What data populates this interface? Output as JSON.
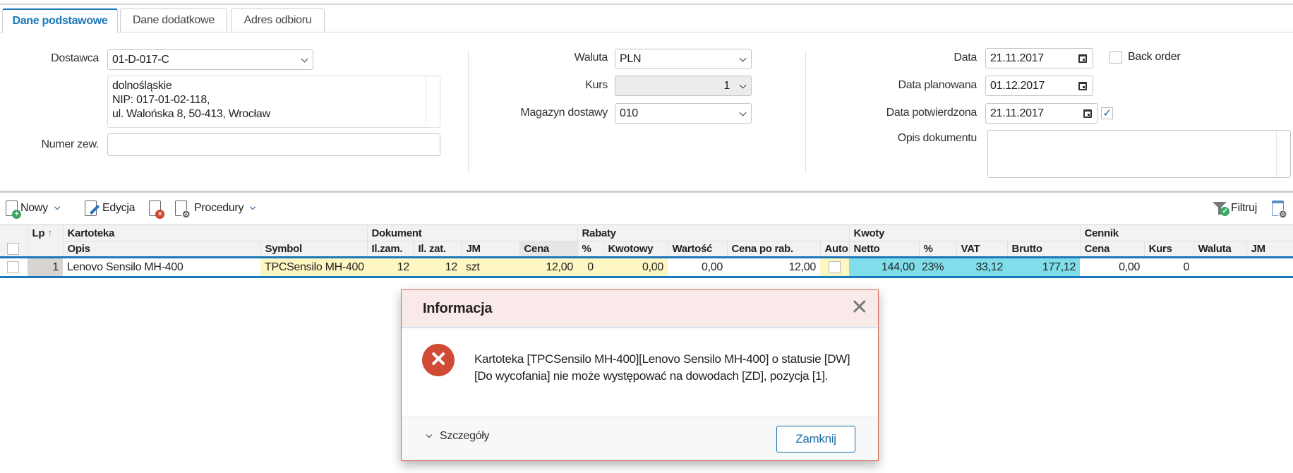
{
  "tabs": [
    {
      "label": "Dane podstawowe",
      "active": true
    },
    {
      "label": "Dane dodatkowe"
    },
    {
      "label": "Adres odbioru"
    }
  ],
  "form": {
    "dostawca": {
      "label": "Dostawca",
      "value": "01-D-017-C"
    },
    "address": [
      "dolnośląskie",
      "NIP: 017-01-02-118,",
      "ul. Walońska 8, 50-413, Wrocław"
    ],
    "numer_zew": {
      "label": "Numer zew.",
      "value": ""
    },
    "waluta": {
      "label": "Waluta",
      "value": "PLN"
    },
    "kurs": {
      "label": "Kurs",
      "value": "1"
    },
    "magazyn": {
      "label": "Magazyn dostawy",
      "value": "010"
    },
    "data": {
      "label": "Data",
      "value": "21.11.2017"
    },
    "back_order": {
      "label": "Back order",
      "checked": false
    },
    "data_planowana": {
      "label": "Data planowana",
      "value": "01.12.2017"
    },
    "data_potwierdzona": {
      "label": "Data potwierdzona",
      "value": "21.11.2017",
      "confirmed": true,
      "check": "✓"
    },
    "opis_dokumentu": {
      "label": "Opis dokumentu",
      "value": ""
    }
  },
  "toolbar": {
    "nowy": "Nowy",
    "edycja": "Edycja",
    "procedury": "Procedury",
    "filtruj": "Filtruj"
  },
  "grid": {
    "groups": {
      "lp": "Lp",
      "kartoteka": "Kartoteka",
      "dokument": "Dokument",
      "rabaty": "Rabaty",
      "kwoty": "Kwoty",
      "cennik": "Cennik"
    },
    "columns": [
      "Opis",
      "Symbol",
      "Il.zam.",
      "Il. zat.",
      "JM",
      "Cena",
      "%",
      "Kwotowy",
      "Wartość",
      "Cena po rab.",
      "Auto",
      "Netto",
      "%",
      "VAT",
      "Brutto",
      "Cena",
      "Kurs",
      "Waluta",
      "JM"
    ],
    "rows": [
      {
        "lp": "1",
        "opis": "Lenovo Sensilo MH-400",
        "symbol": "TPCSensilo MH-400",
        "il_zam": "12",
        "il_zat": "12",
        "jm": "szt",
        "cena": "12,00",
        "rab_pct": "0",
        "kwotowy": "0,00",
        "wartosc": "0,00",
        "cena_po_rab": "12,00",
        "auto": false,
        "netto": "144,00",
        "vat_pct": "23%",
        "vat": "33,12",
        "brutto": "177,12",
        "cennik_cena": "0,00",
        "cennik_kurs": "0",
        "cennik_waluta": "",
        "cennik_jm": ""
      }
    ]
  },
  "dialog": {
    "title": "Informacja",
    "message": "Kartoteka [TPCSensilo MH-400][Lenovo Sensilo MH-400] o statusie [DW][Do wycofania] nie może występować na dowodach [ZD], pozycja [1].",
    "details": "Szczegóły",
    "close": "Zamknij"
  },
  "colors": {
    "accent": "#1a78b8",
    "error": "#cf4b35",
    "yellow": "#fff7c2",
    "cyan": "#80deea"
  }
}
